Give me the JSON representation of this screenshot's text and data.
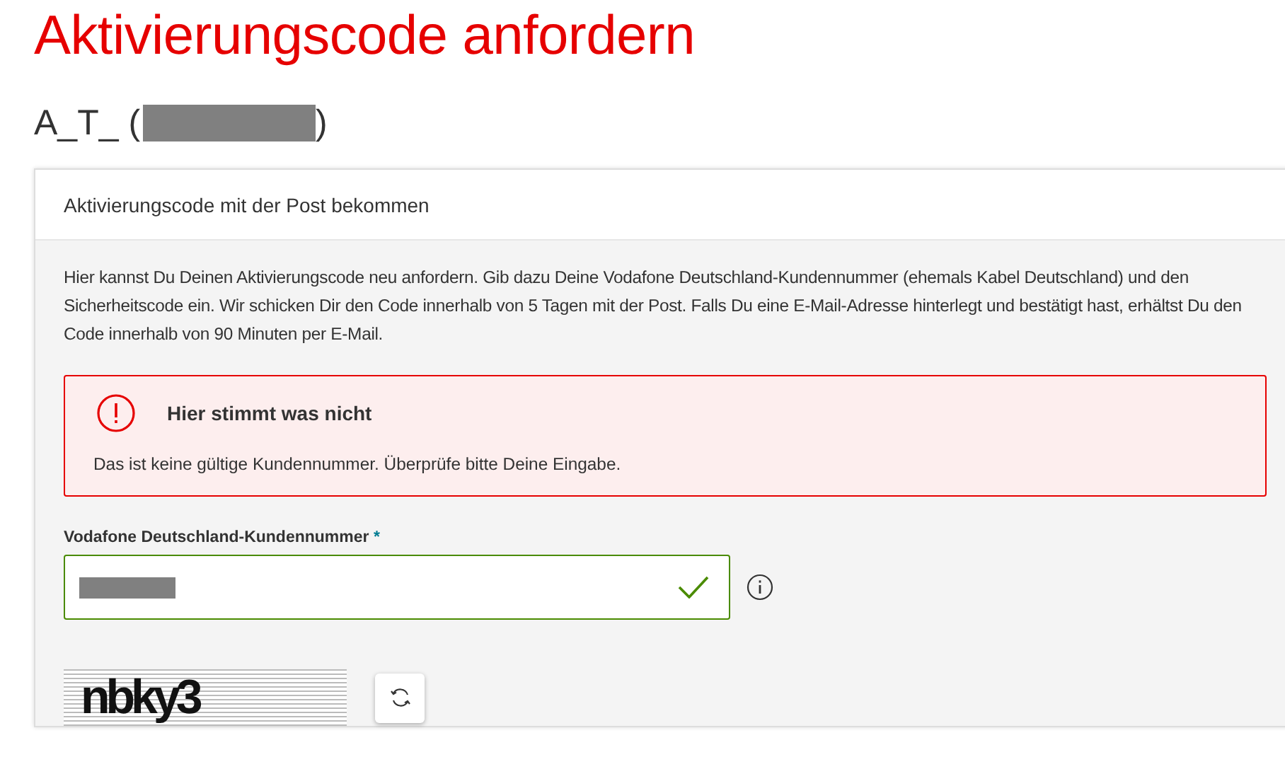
{
  "page_title": "Aktivierungscode anfordern",
  "account": {
    "prefix": "A_T_ (",
    "suffix": ")",
    "redacted": true
  },
  "card": {
    "title": "Aktivierungscode mit der Post bekommen",
    "intro": "Hier kannst Du Deinen Aktivierungscode neu anfordern. Gib dazu Deine Vodafone Deutschland-Kundennummer (ehemals Kabel Deutschland) und den Sicherheitscode ein. Wir schicken Dir den Code innerhalb von 5 Tagen mit der Post. Falls Du eine E-Mail-Adresse hinterlegt und bestätigt hast, erhältst Du den Code innerhalb von 90 Minuten per E-Mail.",
    "alert": {
      "kind": "error",
      "title": "Hier stimmt was nicht",
      "message": "Das ist keine gültige Kundennummer. Überprüfe bitte Deine Eingabe."
    },
    "field": {
      "label": "Vodafone Deutschland-Kundennummer",
      "required_mark": "*",
      "value_redacted": true,
      "valid": true
    },
    "captcha": {
      "text": "nbky3"
    }
  }
}
